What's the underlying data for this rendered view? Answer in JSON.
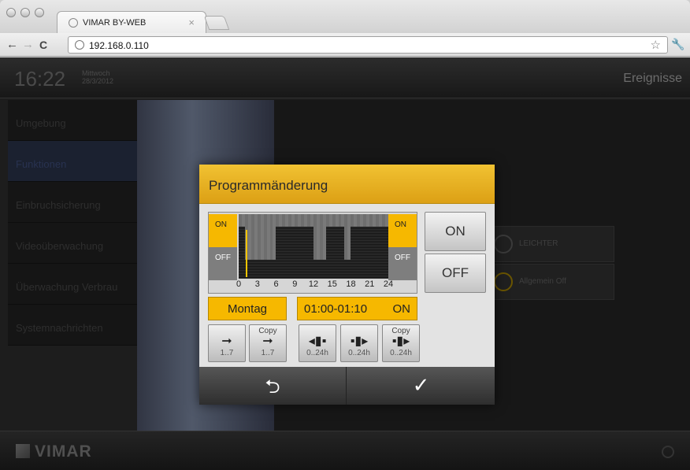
{
  "browser": {
    "tab_title": "VIMAR BY-WEB",
    "tab_close": "×",
    "url": "192.168.0.110",
    "back": "←",
    "forward": "→",
    "reload": "C",
    "star": "☆",
    "wrench": "🔧"
  },
  "header": {
    "time": "16:22",
    "weekday": "Mittwoch",
    "date": "28/3/2012",
    "section": "Ereignisse"
  },
  "sidebar": {
    "items": [
      {
        "label": "Umgebung"
      },
      {
        "label": "Funktionen"
      },
      {
        "label": "Einbruchsicherung"
      },
      {
        "label": "Videoüberwachung"
      },
      {
        "label": "Überwachung Verbrau"
      },
      {
        "label": "Systemnachrichten"
      }
    ]
  },
  "background_buttons": {
    "leichter": "LEICHTER",
    "allgemein_off": "Allgemein Off"
  },
  "footer": {
    "logo": "VIMAR"
  },
  "dialog": {
    "title": "Programmänderung",
    "on_label": "ON",
    "off_label": "OFF",
    "ticks": [
      "0",
      "3",
      "6",
      "9",
      "12",
      "15",
      "18",
      "21",
      "24"
    ],
    "on_button": "ON",
    "off_button": "OFF",
    "day": "Montag",
    "time_range": "01:00-01:10",
    "time_state": "ON",
    "schedule_on_hours": [
      [
        0,
        1
      ],
      [
        6,
        12
      ],
      [
        14,
        17
      ],
      [
        18,
        24
      ]
    ],
    "buttons": [
      {
        "copy": "",
        "arrow": "➞",
        "range": "1..7"
      },
      {
        "copy": "Copy",
        "arrow": "➞",
        "range": "1..7"
      },
      {
        "copy": "",
        "arrow": "◂▮▪",
        "range": "0..24h"
      },
      {
        "copy": "",
        "arrow": "▪▮▸",
        "range": "0..24h"
      },
      {
        "copy": "Copy",
        "arrow": "▪▮▸",
        "range": "0..24h"
      }
    ],
    "back_glyph": "⮌",
    "ok_glyph": "✓"
  }
}
